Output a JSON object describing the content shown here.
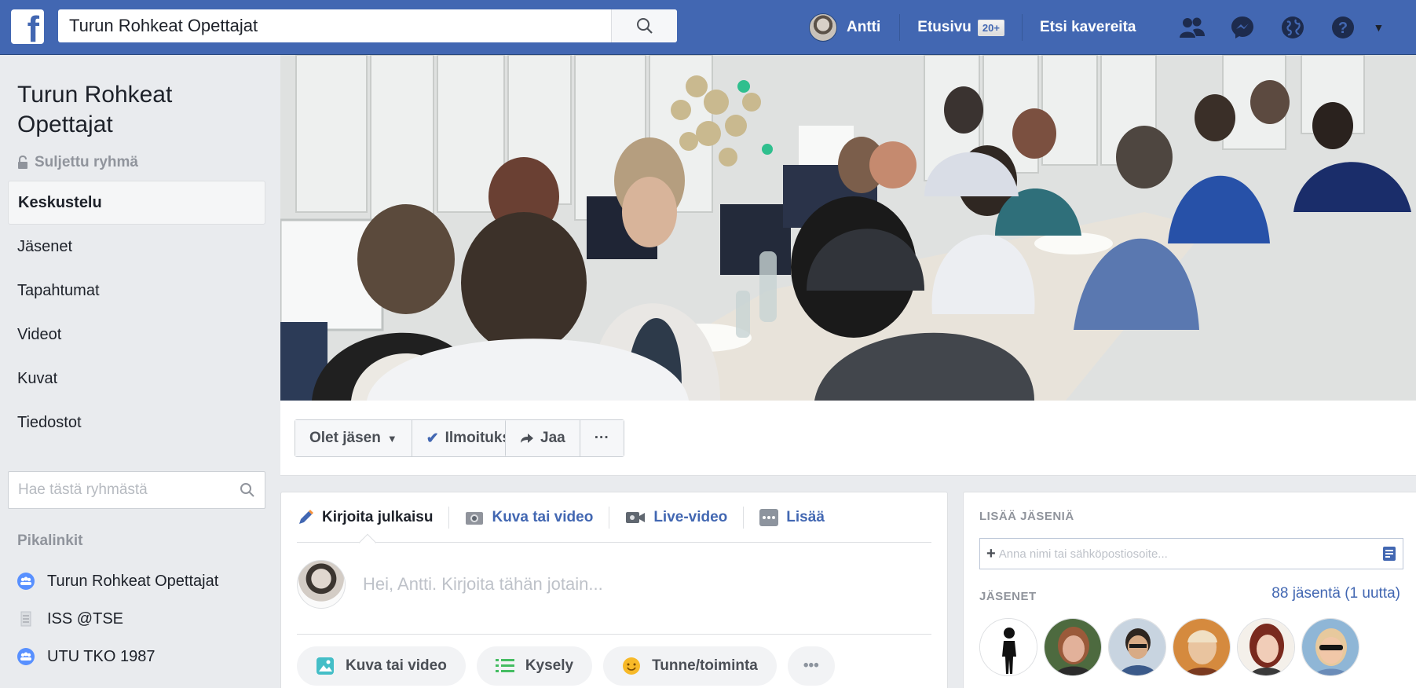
{
  "topbar": {
    "logo": "f",
    "search_value": "Turun Rohkeat Opettajat",
    "user_name": "Antti",
    "home_label": "Etusivu",
    "home_badge": "20+",
    "find_friends": "Etsi kavereita",
    "icons": [
      "friends-icon",
      "messenger-icon",
      "globe-icon",
      "help-icon",
      "caret-down-icon"
    ],
    "brand_color": "#4267b2"
  },
  "sidebar": {
    "group_name": "Turun Rohkeat Opettajat",
    "privacy": "Suljettu ryhmä",
    "nav": [
      "Keskustelu",
      "Jäsenet",
      "Tapahtumat",
      "Videot",
      "Kuvat",
      "Tiedostot"
    ],
    "active_nav": "Keskustelu",
    "search_placeholder": "Hae tästä ryhmästä",
    "shortcuts_title": "Pikalinkit",
    "shortcuts": [
      {
        "label": "Turun Rohkeat Opettajat",
        "icon": "group-icon"
      },
      {
        "label": "ISS @TSE",
        "icon": "page-icon"
      },
      {
        "label": "UTU TKO 1987",
        "icon": "group-icon"
      }
    ]
  },
  "action_bar": {
    "member_button": "Olet jäsen",
    "notifications_button": "Ilmoitukset",
    "share_button": "Jaa",
    "more_button": "···"
  },
  "composer": {
    "tabs": [
      "Kirjoita julkaisu",
      "Kuva tai video",
      "Live-video",
      "Lisää"
    ],
    "placeholder": "Hei, Antti. Kirjoita tähän jotain...",
    "pills": [
      "Kuva tai video",
      "Kysely",
      "Tunne/toiminta"
    ],
    "more": "•••"
  },
  "members_card": {
    "title": "LISÄÄ JÄSENIÄ",
    "input_placeholder": "Anna nimi tai sähköpostiosoite...",
    "subtitle": "JÄSENET",
    "count": "88 jäsentä (1 uutta)"
  }
}
